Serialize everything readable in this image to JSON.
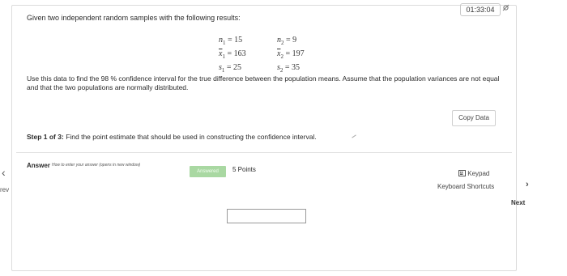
{
  "timer": "01:33:04",
  "question": {
    "intro": "Given two independent random samples with the following results:",
    "stats": {
      "n1": "15",
      "n2": "9",
      "xbar1": "163",
      "xbar2": "197",
      "s1": "25",
      "s2": "35"
    },
    "problem_text": "Use this data to find the 98 % confidence interval for the true difference between the population means. Assume that the population variances are not equal and that the two populations are normally distributed.",
    "copy_data_label": "Copy Data"
  },
  "step": {
    "prefix": "Step 1 of 3:",
    "text": "Find the point estimate that should be used in constructing the confidence interval."
  },
  "answer": {
    "label": "Answer",
    "hint": "How to enter your answer (opens in new window)",
    "status_badge": "Answered",
    "points": "5 Points",
    "keypad_label": "Keypad",
    "keyboard_shortcuts_label": "Keyboard Shortcuts",
    "input_value": ""
  },
  "nav": {
    "prev_label": "rev",
    "next_label": "Next"
  }
}
